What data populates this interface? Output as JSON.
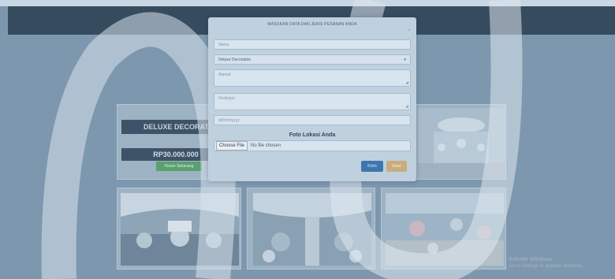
{
  "modal": {
    "title": "MASUKAN DATA DAN JENIS PESANAN ANDA",
    "close": "×",
    "nama_placeholder": "Nama",
    "package_selected": "Deluxe Decoration",
    "alamat_placeholder": "Alamat",
    "deskripsi_placeholder": "Deskripsi",
    "date_placeholder": "dd/mm/yyyy",
    "foto_label": "Foto Lokasi Anda",
    "file_button": "Choose File",
    "file_status": "No file chosen",
    "kirim_label": "Kirim",
    "batal_label": "Batal"
  },
  "card": {
    "title": "DELUXE DECORATI",
    "price": "RP30.000.000",
    "order_label": "Pesan Sekarang"
  },
  "windows_notice": {
    "line1": "Activate Windows",
    "line2": "Go to Settings to activate Windows."
  },
  "colors": {
    "navbar": "#364b5e",
    "kirim": "#3f77ad",
    "batal": "#c7ad7c",
    "order": "#5aa06e"
  }
}
